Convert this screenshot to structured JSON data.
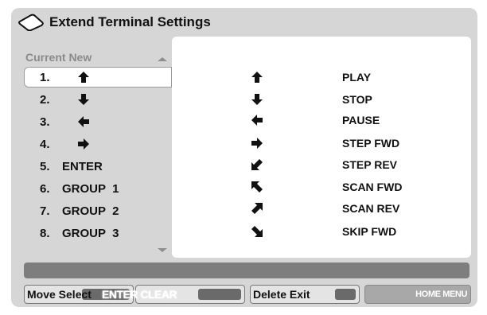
{
  "title": "Extend Terminal Settings",
  "header_icon": "remote-control-icon",
  "left_column": {
    "header": "Current New",
    "rows": [
      {
        "num": "1.",
        "icon": "arrow-up-icon",
        "label": ""
      },
      {
        "num": "2.",
        "icon": "arrow-down-icon",
        "label": ""
      },
      {
        "num": "3.",
        "icon": "arrow-left-icon",
        "label": ""
      },
      {
        "num": "4.",
        "icon": "arrow-right-icon",
        "label": ""
      },
      {
        "num": "5.",
        "icon": "",
        "label": "ENTER"
      },
      {
        "num": "6.",
        "icon": "",
        "label": "GROUP  1"
      },
      {
        "num": "7.",
        "icon": "",
        "label": "GROUP  2"
      },
      {
        "num": "8.",
        "icon": "",
        "label": "GROUP  3"
      }
    ]
  },
  "functions": [
    {
      "icon": "arrow-up-icon",
      "label": "PLAY"
    },
    {
      "icon": "arrow-down-icon",
      "label": "STOP"
    },
    {
      "icon": "arrow-left-icon",
      "label": "PAUSE"
    },
    {
      "icon": "arrow-right-icon",
      "label": "STEP FWD"
    },
    {
      "icon": "arrow-down-left-icon",
      "label": "STEP REV"
    },
    {
      "icon": "arrow-up-left-icon",
      "label": "SCAN FWD"
    },
    {
      "icon": "arrow-up-right-icon",
      "label": "SCAN REV"
    },
    {
      "icon": "arrow-down-right-icon",
      "label": "SKIP FWD"
    }
  ],
  "footer": {
    "move_select": "Move Select",
    "enter_clear": "ENTER CLEAR",
    "delete_exit": "Delete Exit",
    "home_menu": "HOME MENU"
  },
  "colors": {
    "background": "#d6d6d6",
    "panel": "#ffffff",
    "status_bar": "#7e7e7e"
  }
}
